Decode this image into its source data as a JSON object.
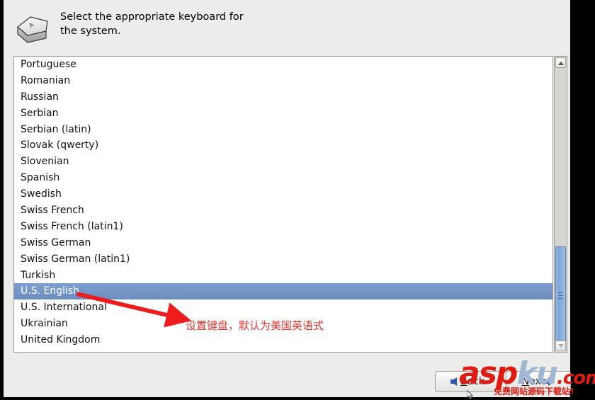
{
  "window": {
    "background_color": "#ececeb",
    "frame_color": "#000000"
  },
  "header": {
    "icon_name": "keyboard-key-icon",
    "icon_letter": "A",
    "instruction_line1": "Select the appropriate keyboard for",
    "instruction_line2": "the system."
  },
  "keyboard_list": {
    "selected": "U.S. English",
    "selection_color": "#7d9fd0",
    "items": [
      "Portuguese",
      "Romanian",
      "Russian",
      "Serbian",
      "Serbian (latin)",
      "Slovak (qwerty)",
      "Slovenian",
      "Spanish",
      "Swedish",
      "Swiss French",
      "Swiss French (latin1)",
      "Swiss German",
      "Swiss German (latin1)",
      "Turkish",
      "U.S. English",
      "U.S. International",
      "Ukrainian",
      "United Kingdom"
    ]
  },
  "scrollbar": {
    "up_arrow_icon": "chevron-up-icon",
    "down_arrow_icon": "chevron-down-icon",
    "thumb_color": "#7fa5d9"
  },
  "annotation": {
    "text": "设置键盘，默认为美国英语式",
    "color": "#e8322c",
    "arrow_icon": "red-arrow-icon"
  },
  "buttons": {
    "back": {
      "label_pre": "",
      "label_key": "B",
      "label_post": "ack",
      "icon": "arrow-left-icon"
    },
    "next": {
      "label_pre": "",
      "label_key": "N",
      "label_post": "ext",
      "icon": "arrow-right-icon"
    }
  },
  "watermark": {
    "part_asp": "asp",
    "part_ku": "ku",
    "part_com": ".com",
    "subtitle": "免费网站源码下载站!",
    "red": "#e01b12",
    "blue": "#9fb6d4"
  }
}
